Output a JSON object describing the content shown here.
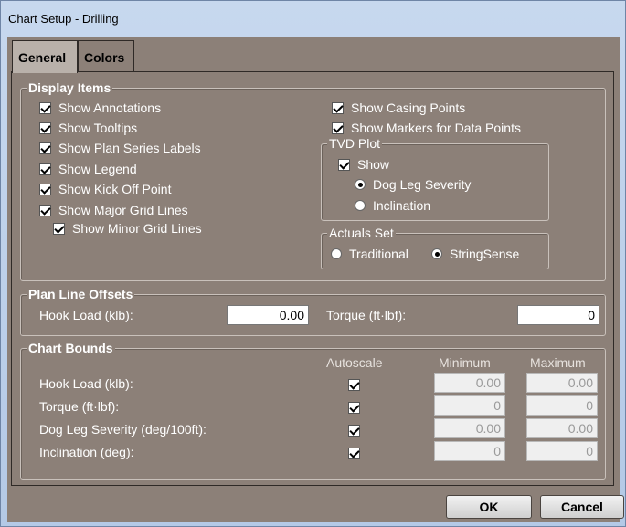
{
  "window": {
    "title": "Chart Setup - Drilling"
  },
  "tabs": [
    {
      "label": "General"
    },
    {
      "label": "Colors"
    }
  ],
  "display_items": {
    "legend": "Display Items",
    "left_checks": [
      {
        "label": "Show Annotations",
        "checked": true
      },
      {
        "label": "Show Tooltips",
        "checked": true
      },
      {
        "label": "Show Plan Series Labels",
        "checked": true
      },
      {
        "label": "Show Legend",
        "checked": true
      },
      {
        "label": "Show Kick Off Point",
        "checked": true
      },
      {
        "label": "Show Major Grid Lines",
        "checked": true
      },
      {
        "label": "Show Minor Grid Lines",
        "checked": true
      }
    ],
    "right_checks": [
      {
        "label": "Show Casing Points",
        "checked": true
      },
      {
        "label": "Show Markers for Data Points",
        "checked": true
      }
    ],
    "tvd_plot": {
      "legend": "TVD Plot",
      "show_label": "Show",
      "show_checked": true,
      "options": [
        {
          "label": "Dog Leg Severity",
          "selected": true
        },
        {
          "label": "Inclination",
          "selected": false
        }
      ]
    },
    "actuals_set": {
      "legend": "Actuals Set",
      "options": [
        {
          "label": "Traditional",
          "selected": false
        },
        {
          "label": "StringSense",
          "selected": true
        }
      ]
    }
  },
  "plan_line_offsets": {
    "legend": "Plan Line Offsets",
    "hook_load_label": "Hook Load  (klb):",
    "hook_load_value": "0.00",
    "torque_label": "Torque (ft·lbf):",
    "torque_value": "0"
  },
  "chart_bounds": {
    "legend": "Chart Bounds",
    "headers": {
      "autoscale": "Autoscale",
      "minimum": "Minimum",
      "maximum": "Maximum"
    },
    "rows": [
      {
        "label": "Hook Load  (klb):",
        "autoscale": true,
        "min": "0.00",
        "max": "0.00"
      },
      {
        "label": "Torque (ft·lbf):",
        "autoscale": true,
        "min": "0",
        "max": "0"
      },
      {
        "label": "Dog Leg Severity (deg/100ft):",
        "autoscale": true,
        "min": "0.00",
        "max": "0.00"
      },
      {
        "label": "Inclination (deg):",
        "autoscale": true,
        "min": "0",
        "max": "0"
      }
    ]
  },
  "buttons": {
    "ok": "OK",
    "cancel": "Cancel"
  }
}
